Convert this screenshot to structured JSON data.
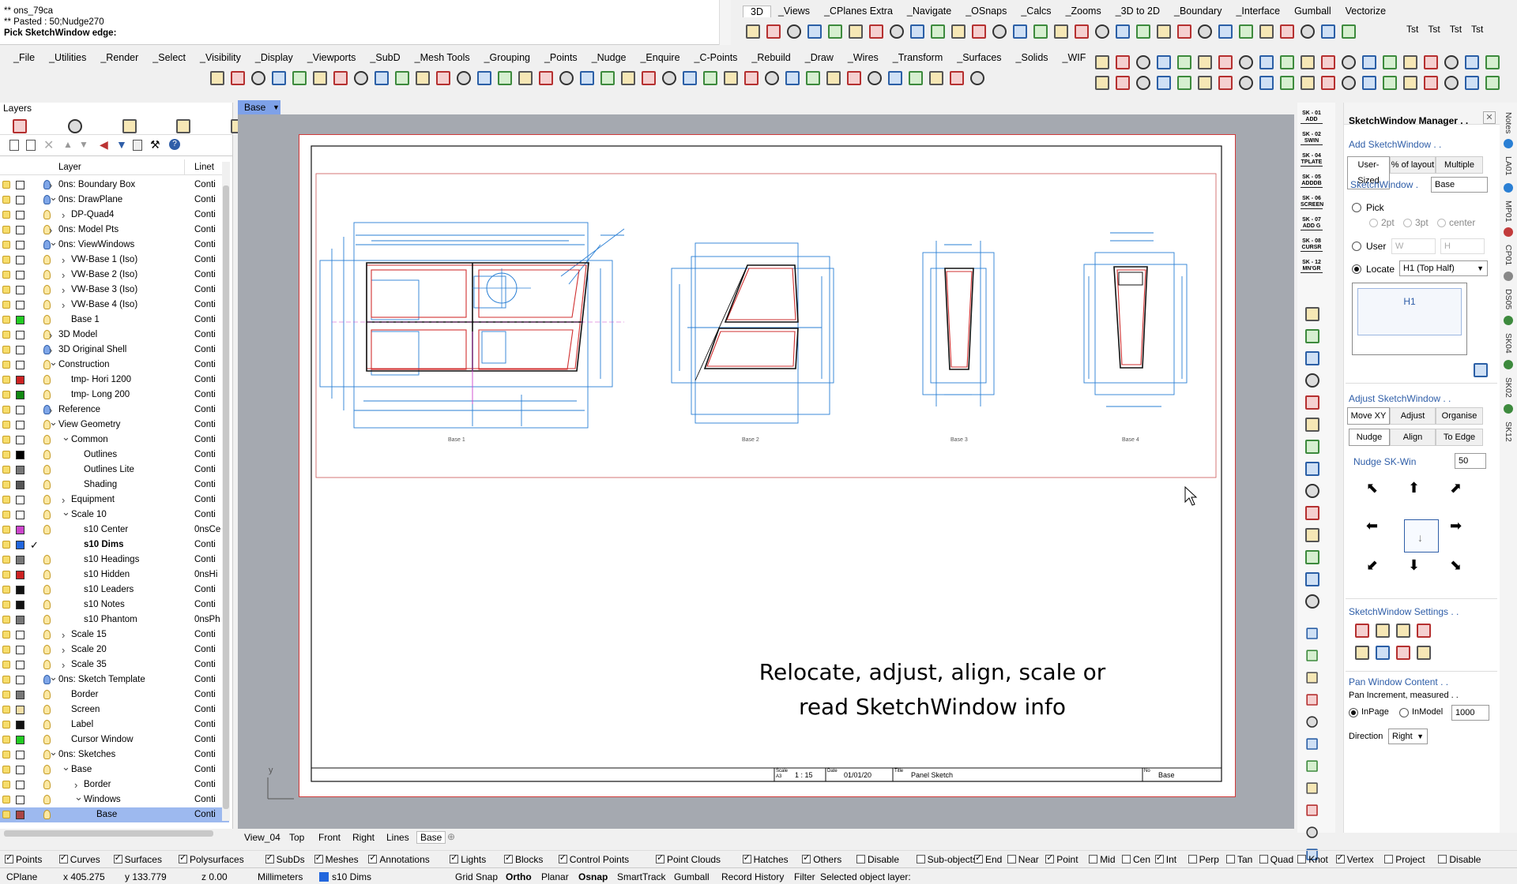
{
  "command": {
    "lines": [
      "** ons_79ca",
      "** Pasted : 50;Nudge270",
      "Pick SketchWindow edge:"
    ]
  },
  "toolbar_tabs_top": [
    "3D",
    "_Views",
    "_CPlanes Extra",
    "_Navigate",
    "_OSnaps",
    "_Calcs",
    "_Zooms",
    "_3D to 2D",
    "_Boundary",
    "_Interface",
    "Gumball",
    "Vectorize"
  ],
  "toolbar_tabs_main": [
    "_File",
    "_Utilities",
    "_Render",
    "_Select",
    "_Visibility",
    "_Display",
    "_Viewports",
    "_SubD",
    "_Mesh Tools",
    "_Grouping",
    "_Points",
    "_Nudge",
    "_Enquire",
    "_C-Points",
    "_Rebuild",
    "_Draw",
    "_Wires",
    "_Transform",
    "_Surfaces",
    "_Solids",
    "_WIF"
  ],
  "tst_labels": [
    "Tst",
    "Tst",
    "Tst",
    "Tst"
  ],
  "layers_panel": {
    "title": "Layers",
    "col_layer": "Layer",
    "col_linetype": "Linet",
    "rows": [
      {
        "name": "0ns: Boundary Box",
        "indent": 0,
        "expand": "›",
        "color": "#ffffff",
        "lt": "Conti",
        "bulb": "blue"
      },
      {
        "name": "0ns: DrawPlane",
        "indent": 0,
        "expand": "⌄",
        "color": "#ffffff",
        "lt": "Conti",
        "bulb": "blue"
      },
      {
        "name": "DP-Quad4",
        "indent": 1,
        "expand": "›",
        "color": "#ffffff",
        "lt": "Conti",
        "bulb": "yellow"
      },
      {
        "name": "0ns: Model Pts",
        "indent": 0,
        "expand": "›",
        "color": "#ffffff",
        "lt": "Conti",
        "bulb": "yellow"
      },
      {
        "name": "0ns: ViewWindows",
        "indent": 0,
        "expand": "⌄",
        "color": "#ffffff",
        "lt": "Conti",
        "bulb": "blue"
      },
      {
        "name": "VW-Base 1 (Iso)",
        "indent": 1,
        "expand": "›",
        "color": "#ffffff",
        "lt": "Conti",
        "bulb": "yellow"
      },
      {
        "name": "VW-Base 2 (Iso)",
        "indent": 1,
        "expand": "›",
        "color": "#ffffff",
        "lt": "Conti",
        "bulb": "yellow"
      },
      {
        "name": "VW-Base 3 (Iso)",
        "indent": 1,
        "expand": "›",
        "color": "#ffffff",
        "lt": "Conti",
        "bulb": "yellow"
      },
      {
        "name": "VW-Base 4 (Iso)",
        "indent": 1,
        "expand": "›",
        "color": "#ffffff",
        "lt": "Conti",
        "bulb": "yellow"
      },
      {
        "name": "Base 1",
        "indent": 1,
        "expand": "",
        "color": "#22cc22",
        "lt": "Conti",
        "bulb": "yellow"
      },
      {
        "name": "3D Model",
        "indent": 0,
        "expand": "›",
        "color": "#ffffff",
        "lt": "Conti",
        "bulb": "yellow"
      },
      {
        "name": "3D Original Shell",
        "indent": 0,
        "expand": "›",
        "color": "#ffffff",
        "lt": "Conti",
        "bulb": "blue"
      },
      {
        "name": "Construction",
        "indent": 0,
        "expand": "⌄",
        "color": "#ffffff",
        "lt": "Conti",
        "bulb": "yellow"
      },
      {
        "name": "tmp- Hori 1200",
        "indent": 1,
        "expand": "",
        "color": "#cc2222",
        "lt": "Conti",
        "bulb": "yellow"
      },
      {
        "name": "tmp- Long 200",
        "indent": 1,
        "expand": "",
        "color": "#118811",
        "lt": "Conti",
        "bulb": "yellow"
      },
      {
        "name": "Reference",
        "indent": 0,
        "expand": "›",
        "color": "#ffffff",
        "lt": "Conti",
        "bulb": "blue"
      },
      {
        "name": "View Geometry",
        "indent": 0,
        "expand": "⌄",
        "color": "#ffffff",
        "lt": "Conti",
        "bulb": "yellow"
      },
      {
        "name": "Common",
        "indent": 1,
        "expand": "⌄",
        "color": "#ffffff",
        "lt": "Conti",
        "bulb": "yellow"
      },
      {
        "name": "Outlines",
        "indent": 2,
        "expand": "",
        "color": "#000000",
        "lt": "Conti",
        "bulb": "yellow"
      },
      {
        "name": "Outlines Lite",
        "indent": 2,
        "expand": "",
        "color": "#777777",
        "lt": "Conti",
        "bulb": "yellow"
      },
      {
        "name": "Shading",
        "indent": 2,
        "expand": "",
        "color": "#555555",
        "lt": "Conti",
        "bulb": "yellow"
      },
      {
        "name": "Equipment",
        "indent": 1,
        "expand": "›",
        "color": "#ffffff",
        "lt": "Conti",
        "bulb": "yellow"
      },
      {
        "name": "Scale 10",
        "indent": 1,
        "expand": "⌄",
        "color": "#ffffff",
        "lt": "Conti",
        "bulb": "yellow"
      },
      {
        "name": "s10 Center",
        "indent": 2,
        "expand": "",
        "color": "#cc44cc",
        "lt": "0nsCe",
        "bulb": "yellow"
      },
      {
        "name": "s10 Dims",
        "indent": 2,
        "expand": "",
        "color": "#2266dd",
        "lt": "Conti",
        "bulb": "none",
        "current": true
      },
      {
        "name": "s10 Headings",
        "indent": 2,
        "expand": "",
        "color": "#777777",
        "lt": "Conti",
        "bulb": "yellow"
      },
      {
        "name": "s10 Hidden",
        "indent": 2,
        "expand": "",
        "color": "#cc2222",
        "lt": "0nsHi",
        "bulb": "yellow"
      },
      {
        "name": "s10 Leaders",
        "indent": 2,
        "expand": "",
        "color": "#111111",
        "lt": "Conti",
        "bulb": "yellow"
      },
      {
        "name": "s10 Notes",
        "indent": 2,
        "expand": "",
        "color": "#111111",
        "lt": "Conti",
        "bulb": "yellow"
      },
      {
        "name": "s10 Phantom",
        "indent": 2,
        "expand": "",
        "color": "#777777",
        "lt": "0nsPh",
        "bulb": "yellow"
      },
      {
        "name": "Scale 15",
        "indent": 1,
        "expand": "›",
        "color": "#ffffff",
        "lt": "Conti",
        "bulb": "yellow"
      },
      {
        "name": "Scale 20",
        "indent": 1,
        "expand": "›",
        "color": "#ffffff",
        "lt": "Conti",
        "bulb": "yellow"
      },
      {
        "name": "Scale 35",
        "indent": 1,
        "expand": "›",
        "color": "#ffffff",
        "lt": "Conti",
        "bulb": "yellow"
      },
      {
        "name": "0ns: Sketch Template",
        "indent": 0,
        "expand": "⌄",
        "color": "#ffffff",
        "lt": "Conti",
        "bulb": "blue"
      },
      {
        "name": "Border",
        "indent": 1,
        "expand": "",
        "color": "#777777",
        "lt": "Conti",
        "bulb": "yellow"
      },
      {
        "name": "Screen",
        "indent": 1,
        "expand": "",
        "color": "#f6e0a8",
        "lt": "Conti",
        "bulb": "yellow"
      },
      {
        "name": "Label",
        "indent": 1,
        "expand": "",
        "color": "#111111",
        "lt": "Conti",
        "bulb": "yellow"
      },
      {
        "name": "Cursor Window",
        "indent": 1,
        "expand": "",
        "color": "#22cc22",
        "lt": "Conti",
        "bulb": "yellow"
      },
      {
        "name": "0ns: Sketches",
        "indent": 0,
        "expand": "⌄",
        "color": "#ffffff",
        "lt": "Conti",
        "bulb": "yellow"
      },
      {
        "name": "Base",
        "indent": 1,
        "expand": "⌄",
        "color": "#ffffff",
        "lt": "Conti",
        "bulb": "yellow"
      },
      {
        "name": "Border",
        "indent": 2,
        "expand": "›",
        "color": "#ffffff",
        "lt": "Conti",
        "bulb": "yellow"
      },
      {
        "name": "Windows",
        "indent": 2,
        "expand": "⌄",
        "color": "#ffffff",
        "lt": "Conti",
        "bulb": "yellow"
      },
      {
        "name": "Base",
        "indent": 3,
        "expand": "",
        "color": "#aa4444",
        "lt": "Conti",
        "bulb": "yellow",
        "selected": true
      }
    ]
  },
  "viewport": {
    "tab": "Base",
    "subtitle_line1": "Relocate, adjust, align, scale or",
    "subtitle_line2": "read SketchWindow info",
    "sketch_labels": [
      "Base 1",
      "Base 2",
      "Base 3",
      "Base 4"
    ],
    "titleblock": {
      "scale_label": "Scale",
      "scale_sub": "A3",
      "scale": "1 : 15",
      "date_label": "Date",
      "date": "01/01/20",
      "title_label": "Title",
      "title": "Panel Sketch",
      "no_label": "No",
      "no": "Base"
    },
    "axis_y": "y"
  },
  "bottom_tabs": [
    "View_04",
    "Top",
    "Front",
    "Right",
    "Lines",
    "Base"
  ],
  "sk_buttons": [
    {
      "top": "SK - 01",
      "bot": "ADD"
    },
    {
      "top": "SK - 02",
      "bot": "SWIN"
    },
    {
      "top": "SK - 04",
      "bot": "TPLATE"
    },
    {
      "top": "SK - 05",
      "bot": "ADDDB"
    },
    {
      "top": "SK - 06",
      "bot": "SCREEN"
    },
    {
      "top": "SK - 07",
      "bot": "ADD G"
    },
    {
      "top": "SK - 08",
      "bot": "CURSR"
    },
    {
      "top": "SK - 12",
      "bot": "MN'GR"
    }
  ],
  "manager": {
    "title": "SketchWindow Manager . .",
    "add": "Add SketchWindow . .",
    "tabs": [
      "User-Sized",
      "% of layout",
      "Multiple"
    ],
    "sketchwindow_label": "SketchWindow .",
    "sketchwindow_value": "Base",
    "pick": "Pick",
    "opt_2pt": "2pt",
    "opt_3pt": "3pt",
    "opt_center": "center",
    "user": "User",
    "w_ph": "W",
    "h_ph": "H",
    "locate": "Locate",
    "locate_value": "H1  (Top Half)",
    "preview_label": "H1",
    "adjust": "Adjust SketchWindow . .",
    "adjust_tabs": [
      "Move XY",
      "Adjust",
      "Organise"
    ],
    "nudge_tabs": [
      "Nudge",
      "Align",
      "To Edge"
    ],
    "nudge_label": "Nudge SK-Win",
    "nudge_value": "50",
    "settings": "SketchWindow Settings . .",
    "pan": "Pan Window Content . .",
    "pan_inc": "Pan Increment, measured . .",
    "inpage": "InPage",
    "inmodel": "InModel",
    "inc_value": "1000",
    "direction": "Direction",
    "direction_value": "Right"
  },
  "right_vertical_tabs": [
    "Notes",
    "LA01",
    "MP01",
    "CP01",
    "DS05",
    "SK04",
    "SK02",
    "SK12"
  ],
  "filters": {
    "left": [
      {
        "label": "Points",
        "on": true
      },
      {
        "label": "Curves",
        "on": true
      },
      {
        "label": "Surfaces",
        "on": true
      },
      {
        "label": "Polysurfaces",
        "on": true
      },
      {
        "label": "SubDs",
        "on": true
      },
      {
        "label": "Meshes",
        "on": true
      },
      {
        "label": "Annotations",
        "on": true
      },
      {
        "label": "Lights",
        "on": true
      },
      {
        "label": "Blocks",
        "on": true
      },
      {
        "label": "Control Points",
        "on": true
      },
      {
        "label": "Point Clouds",
        "on": true
      },
      {
        "label": "Hatches",
        "on": true
      },
      {
        "label": "Others",
        "on": true
      },
      {
        "label": "Disable",
        "on": false
      },
      {
        "label": "Sub-objects",
        "on": false
      }
    ],
    "right": [
      {
        "label": "End",
        "on": true
      },
      {
        "label": "Near",
        "on": false
      },
      {
        "label": "Point",
        "on": true
      },
      {
        "label": "Mid",
        "on": false
      },
      {
        "label": "Cen",
        "on": false
      },
      {
        "label": "Int",
        "on": true
      },
      {
        "label": "Perp",
        "on": false
      },
      {
        "label": "Tan",
        "on": false
      },
      {
        "label": "Quad",
        "on": false
      },
      {
        "label": "Knot",
        "on": false
      },
      {
        "label": "Vertex",
        "on": true
      },
      {
        "label": "Project",
        "on": false
      },
      {
        "label": "Disable",
        "on": false
      }
    ]
  },
  "status": {
    "cplane": "CPlane",
    "x": "x 405.275",
    "y": "y 133.779",
    "z": "z 0.00",
    "units": "Millimeters",
    "layer": "s10 Dims",
    "grid_snap": "Grid Snap",
    "ortho": "Ortho",
    "planar": "Planar",
    "osnap": "Osnap",
    "smarttrack": "SmartTrack",
    "gumball": "Gumball",
    "history": "Record History",
    "filter": "Filter",
    "message": "Selected object layer:"
  },
  "colors": {
    "accent": "#2f5ea8",
    "selection": "#9db9ef",
    "sketch_blue": "#2a7fd4",
    "sketch_red": "#d03030"
  }
}
